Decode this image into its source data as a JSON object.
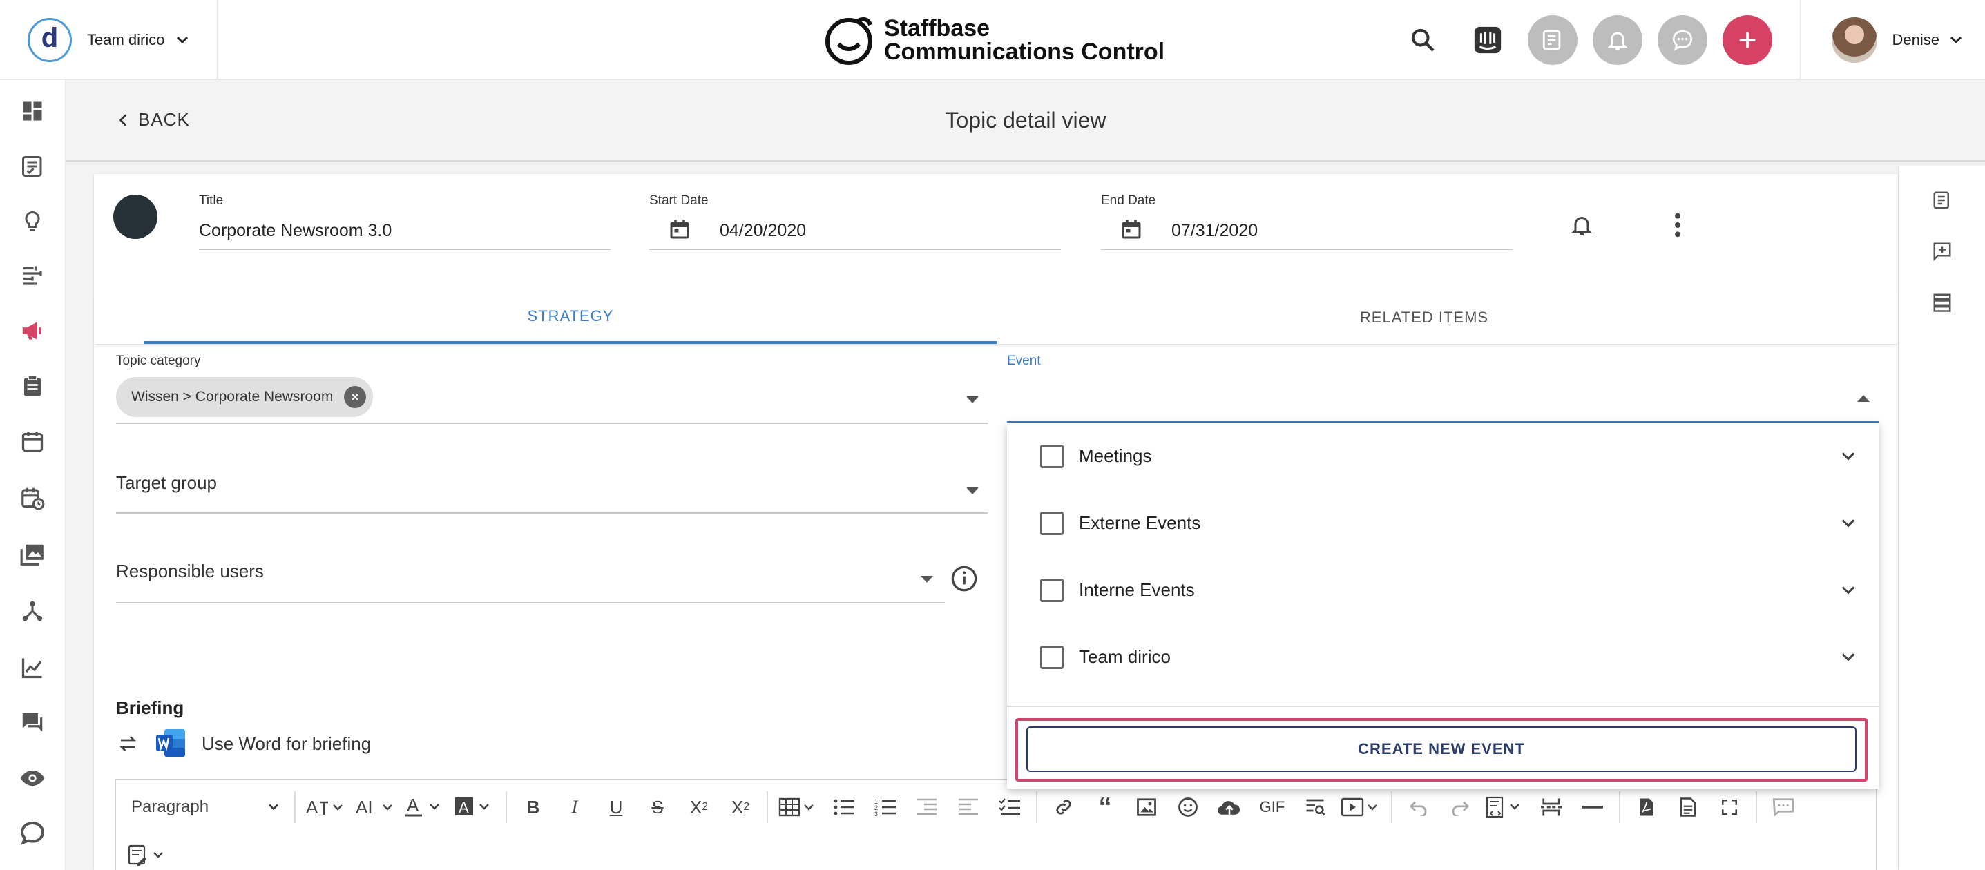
{
  "header": {
    "team_name": "Team dirico",
    "brand_line1": "Staffbase",
    "brand_line2": "Communications Control",
    "user_name": "Denise",
    "icons": [
      "search-icon",
      "intercom-icon",
      "tasks-icon",
      "bell-icon",
      "chat-icon",
      "plus-icon"
    ]
  },
  "sidebar": {
    "items": [
      "dashboard-icon",
      "checklist-icon",
      "lightbulb-icon",
      "planning-icon",
      "megaphone-icon",
      "clipboard-icon",
      "calendar-icon",
      "calendar-clock-icon",
      "media-icon",
      "network-icon",
      "analytics-icon",
      "comments-icon",
      "eye-icon",
      "chat-bubble-icon"
    ]
  },
  "subheader": {
    "back_label": "BACK",
    "title": "Topic detail view"
  },
  "topic": {
    "title_label": "Title",
    "title_value": "Corporate Newsroom 3.0",
    "start_label": "Start Date",
    "start_value": "04/20/2020",
    "end_label": "End Date",
    "end_value": "07/31/2020"
  },
  "tabs": [
    {
      "label": "STRATEGY",
      "active": true
    },
    {
      "label": "RELATED ITEMS",
      "active": false
    }
  ],
  "form": {
    "topic_category_label": "Topic category",
    "topic_category_chip": "Wissen > Corporate Newsroom",
    "event_label": "Event",
    "target_group_label": "Target group",
    "responsible_users_label": "Responsible users",
    "briefing_label": "Briefing",
    "word_label": "Use Word for briefing"
  },
  "editor": {
    "paragraph_select": "Paragraph",
    "gif_label": "GIF"
  },
  "dropdown": {
    "items": [
      "Meetings",
      "Externe Events",
      "Interne Events",
      "Team dirico"
    ],
    "create_label": "CREATE NEW EVENT"
  },
  "colors": {
    "accent_blue": "#3d7dc4",
    "brand_red": "#d64264",
    "highlight": "#d2466d",
    "navy": "#2b3e6b"
  }
}
